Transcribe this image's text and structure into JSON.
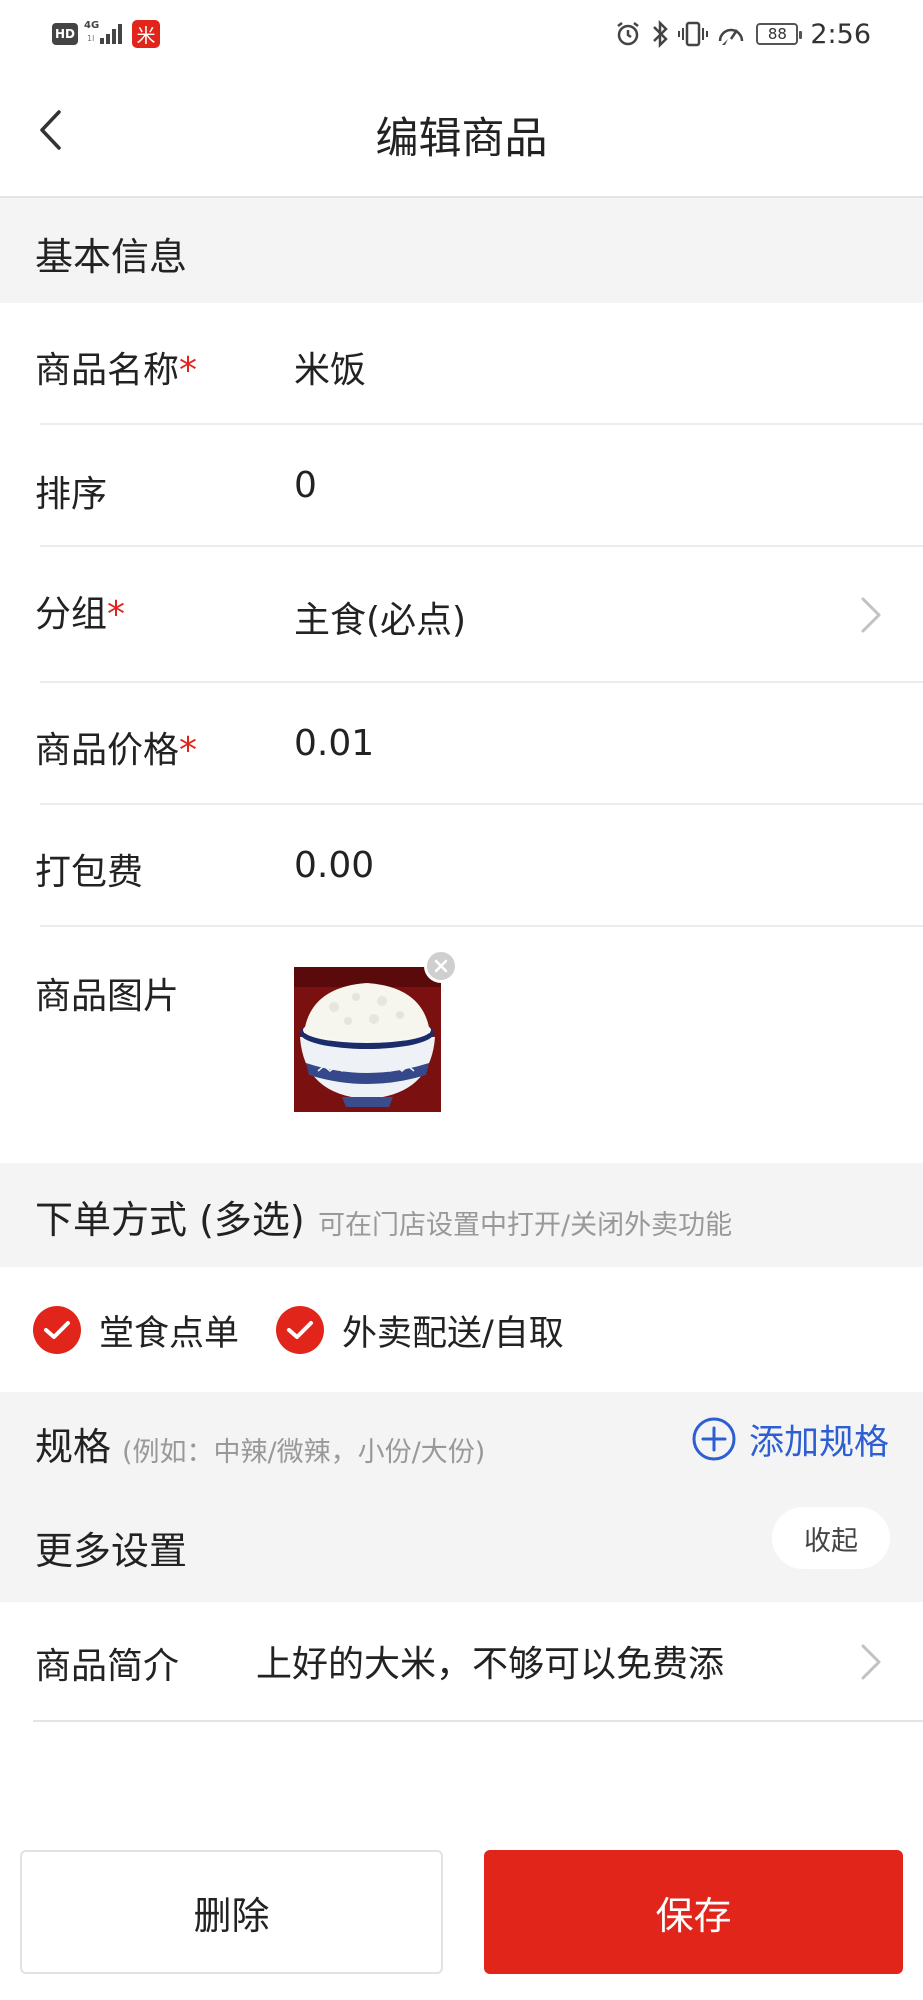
{
  "status_bar": {
    "hd_label": "HD",
    "network_label": "4G",
    "network_sub_label": "1l",
    "mi_label": "米",
    "battery": "88",
    "time": "2:56",
    "icons": [
      "alarm-icon",
      "bluetooth-icon",
      "vibrate-icon",
      "data-speed-icon",
      "battery-icon"
    ]
  },
  "header": {
    "title": "编辑商品",
    "back_icon": "chevron-left-icon"
  },
  "basic_info": {
    "section_title": "基本信息",
    "fields": {
      "name": {
        "label": "商品名称",
        "required_mark": "*",
        "value": "米饭"
      },
      "sort": {
        "label": "排序",
        "value": "0"
      },
      "group": {
        "label": "分组",
        "required_mark": "*",
        "value": "主食(必点)"
      },
      "price": {
        "label": "商品价格",
        "required_mark": "*",
        "value": "0.01"
      },
      "packing_fee": {
        "label": "打包费",
        "value": "0.00"
      },
      "image": {
        "label": "商品图片"
      }
    }
  },
  "order_mode": {
    "section_title": "下单方式 (多选)",
    "hint": "可在门店设置中打开/关闭外卖功能",
    "options": [
      {
        "label": "堂食点单",
        "checked": true
      },
      {
        "label": "外卖配送/自取",
        "checked": true
      }
    ]
  },
  "spec": {
    "title": "规格",
    "hint": "(例如：中辣/微辣，小份/大份)",
    "add_label": "添加规格"
  },
  "more_settings": {
    "title": "更多设置",
    "collapse_label": "收起"
  },
  "description": {
    "label": "商品简介",
    "value": "上好的大米，不够可以免费添"
  },
  "actions": {
    "delete_label": "删除",
    "save_label": "保存"
  },
  "colors": {
    "accent": "#e1251b",
    "link": "#2d5fd3",
    "section_bg": "#f4f4f4",
    "hint_text": "#999999"
  }
}
